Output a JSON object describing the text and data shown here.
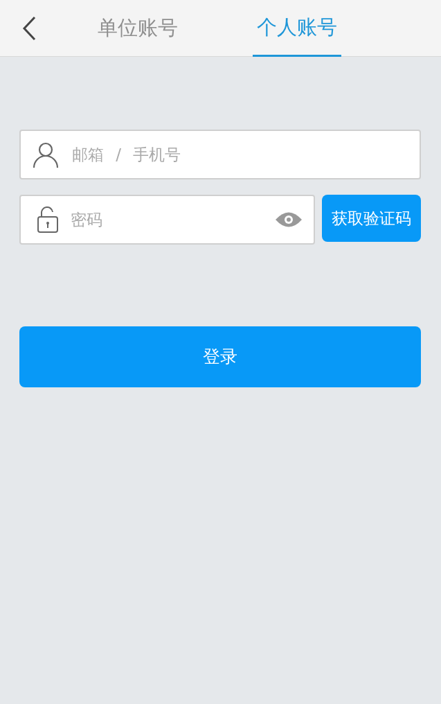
{
  "tabs": [
    {
      "label": "单位账号",
      "selected": false
    },
    {
      "label": "个人账号",
      "selected": true
    }
  ],
  "account_field": {
    "placeholder": "邮箱 / 手机号"
  },
  "password_field": {
    "placeholder": "密码"
  },
  "code_button": "获取验证码",
  "login_button": "登录"
}
